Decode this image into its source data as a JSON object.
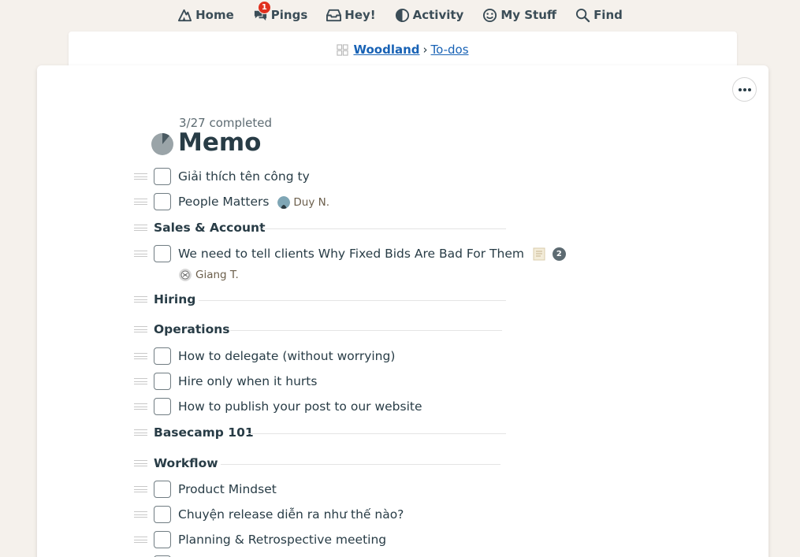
{
  "nav": {
    "home": "Home",
    "pings": "Pings",
    "pings_badge": "1",
    "hey": "Hey!",
    "activity": "Activity",
    "mystuff": "My Stuff",
    "find": "Find"
  },
  "breadcrumb": {
    "project": "Woodland",
    "separator": "›",
    "section": "To-dos"
  },
  "list": {
    "completed": "3/27 completed",
    "title": "Memo"
  },
  "items": {
    "i1": {
      "label": "Giải thích tên công ty"
    },
    "i2": {
      "label": "People Matters",
      "assignee": "Duy N."
    },
    "g1": {
      "label": "Sales & Account"
    },
    "i3": {
      "label": "We need to tell clients Why Fixed Bids Are Bad For Them",
      "comments": "2",
      "assignee": "Giang T."
    },
    "g2": {
      "label": "Hiring"
    },
    "g3": {
      "label": "Operations"
    },
    "i4": {
      "label": "How to delegate (without worrying)"
    },
    "i5": {
      "label": "Hire only when it hurts"
    },
    "i6": {
      "label": "How to publish your post to our website"
    },
    "g4": {
      "label": "Basecamp 101"
    },
    "g5": {
      "label": "Workflow"
    },
    "i7": {
      "label": "Product Mindset"
    },
    "i8": {
      "label": "Chuyện release diễn ra như thế nào?"
    },
    "i9": {
      "label": "Planning & Retrospective meeting"
    }
  },
  "colors": {
    "background": "#f5f1ec",
    "link": "#1862b5",
    "text": "#283c46",
    "badge": "#e0301e"
  }
}
